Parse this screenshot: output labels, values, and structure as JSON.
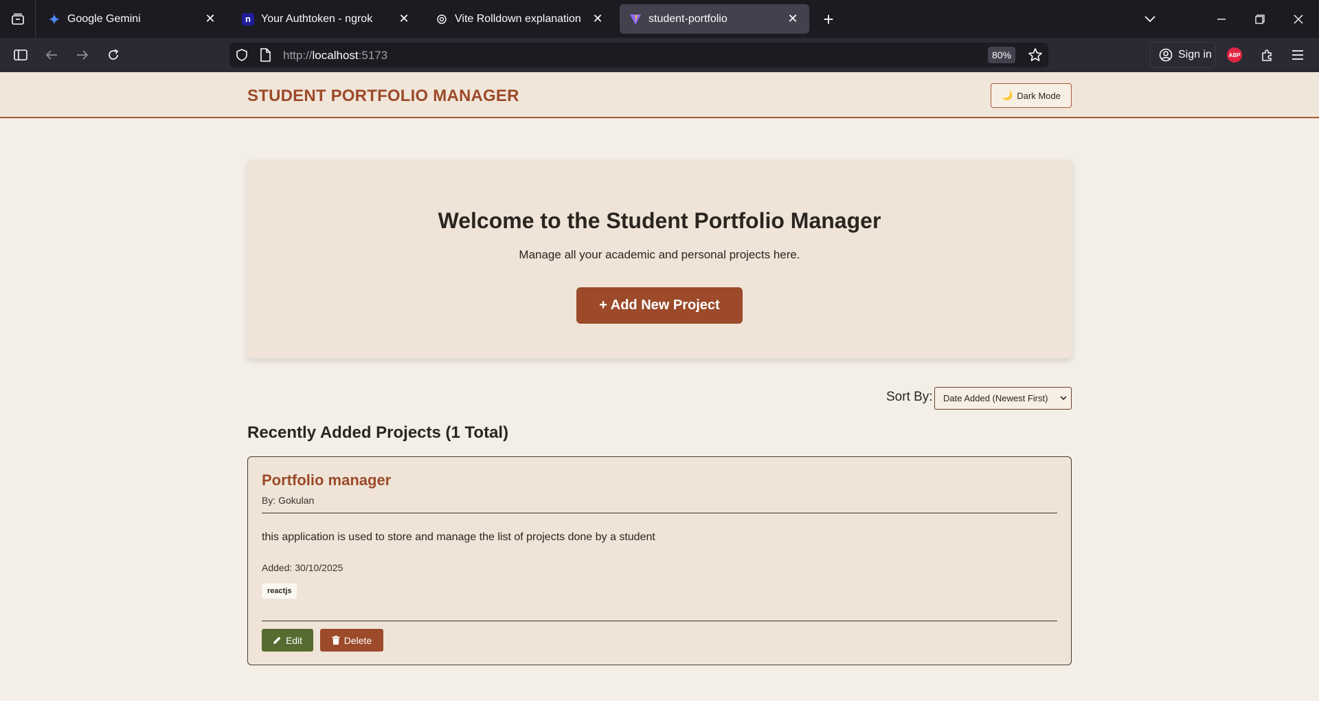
{
  "browser": {
    "tabs": [
      {
        "title": "Google Gemini",
        "icon": "gemini-icon"
      },
      {
        "title": "Your Authtoken - ngrok",
        "icon": "ngrok-icon"
      },
      {
        "title": "Vite Rolldown explanation",
        "icon": "openai-icon"
      },
      {
        "title": "student-portfolio",
        "icon": "vite-icon",
        "active": true
      }
    ],
    "url_scheme": "http://",
    "url_host": "localhost",
    "url_port": ":5173",
    "zoom": "80%",
    "signin_label": "Sign in",
    "abp_label": "ABP"
  },
  "app": {
    "brand": "STUDENT PORTFOLIO MANAGER",
    "dark_mode_label": "Dark Mode",
    "hero": {
      "title": "Welcome to the Student Portfolio Manager",
      "subtitle": "Manage all your academic and personal projects here.",
      "add_button": "+ Add New Project"
    },
    "sort": {
      "label": "Sort By:",
      "selected": "Date Added (Newest First)"
    },
    "section_title": "Recently Added Projects (1 Total)",
    "projects": [
      {
        "title": "Portfolio manager",
        "author": "By: Gokulan",
        "description": "this application is used to store and manage the list of projects done by a student",
        "added": "Added: 30/10/2025",
        "tags": [
          "reactjs"
        ],
        "edit_label": "Edit",
        "delete_label": "Delete"
      }
    ]
  },
  "colors": {
    "accent": "#9c4a2a",
    "edit": "#556b2f",
    "page_bg": "#f3eee6",
    "card_bg": "#efe4d7"
  }
}
